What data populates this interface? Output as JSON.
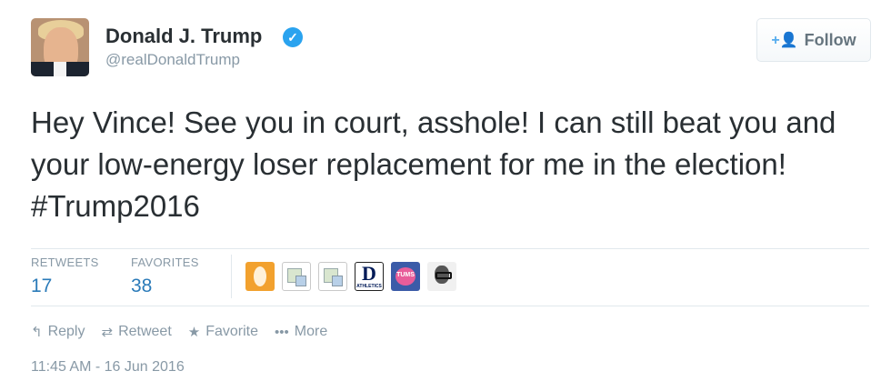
{
  "user": {
    "display_name": "Donald J. Trump",
    "handle": "@realDonaldTrump",
    "verified_icon": "verified-badge-icon",
    "verified_glyph": "✓",
    "accent_color": "#55acee"
  },
  "follow_button": {
    "label": "Follow",
    "icon_glyph": "+👤"
  },
  "tweet": {
    "text": "Hey Vince! See you in court, asshole! I can still beat you and your low-energy loser replacement for me in the election! #Trump2016"
  },
  "stats": {
    "retweets_label": "RETWEETS",
    "retweets_value": "17",
    "favorites_label": "FAVORITES",
    "favorites_value": "38"
  },
  "favoriter_avatars": {
    "duke_letter": "D",
    "duke_sub": "ATHLETICS",
    "tums_label": "TUMS"
  },
  "actions": {
    "reply_label": "Reply",
    "reply_glyph": "↰",
    "retweet_label": "Retweet",
    "retweet_glyph": "⇄",
    "favorite_label": "Favorite",
    "favorite_glyph": "★",
    "more_label": "More",
    "more_glyph": "•••"
  },
  "timestamp": "11:45 AM - 16 Jun 2016"
}
